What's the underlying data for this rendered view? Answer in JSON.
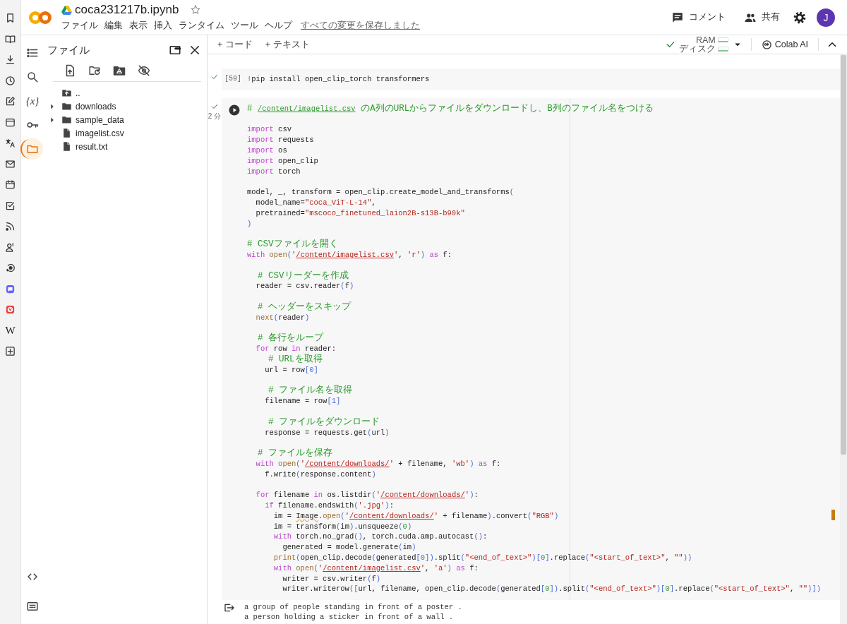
{
  "browser_panels": [
    {
      "kind": "bookmarks"
    },
    {
      "kind": "reader"
    },
    {
      "kind": "downloads"
    },
    {
      "kind": "history"
    },
    {
      "kind": "notes"
    },
    {
      "kind": "tabs"
    },
    {
      "kind": "translate"
    },
    {
      "kind": "mail"
    },
    {
      "kind": "calendar"
    },
    {
      "kind": "tasks"
    },
    {
      "kind": "feeds"
    },
    {
      "kind": "contacts"
    },
    {
      "kind": "chat"
    },
    {
      "kind": "mastodon"
    },
    {
      "kind": "vivaldi"
    },
    {
      "kind": "wikipedia",
      "glyph": "W"
    },
    {
      "kind": "add"
    }
  ],
  "header": {
    "title": "coca231217b.ipynb",
    "menu": [
      "ファイル",
      "編集",
      "表示",
      "挿入",
      "ランタイム",
      "ツール",
      "ヘルプ"
    ],
    "save_status": "すべての変更を保存しました",
    "actions": [
      {
        "kind": "comment",
        "label": "コメント"
      },
      {
        "kind": "share",
        "label": "共有"
      },
      {
        "kind": "settings"
      }
    ],
    "avatar": "J"
  },
  "toolbar": {
    "add_buttons": [
      "+ コード",
      "+ テキスト"
    ],
    "runtime": {
      "connected": true,
      "ram_label": "RAM",
      "disk_label": "ディスク"
    },
    "ai_button": "Colab AI"
  },
  "rail": [
    {
      "kind": "toc",
      "selected": false
    },
    {
      "kind": "search",
      "selected": false
    },
    {
      "kind": "variables",
      "glyph": "{x}",
      "selected": false
    },
    {
      "kind": "secrets",
      "selected": false
    },
    {
      "kind": "files",
      "selected": true
    }
  ],
  "rail_bottom": [
    {
      "kind": "code_snippets"
    },
    {
      "kind": "terminal"
    }
  ],
  "file_panel": {
    "title": "ファイル",
    "tools": [
      {
        "kind": "upload"
      },
      {
        "kind": "refresh"
      },
      {
        "kind": "drive"
      },
      {
        "kind": "hidden"
      }
    ],
    "tree": [
      {
        "kind": "parent",
        "name": ".."
      },
      {
        "kind": "folder",
        "name": "downloads",
        "expanded": false
      },
      {
        "kind": "folder",
        "name": "sample_data",
        "expanded": false
      },
      {
        "kind": "file",
        "name": "imagelist.csv"
      },
      {
        "kind": "file",
        "name": "result.txt"
      }
    ]
  },
  "cells": [
    {
      "executed": true,
      "count": "[59]",
      "lines": [
        {
          "kind": "code",
          "segments": [
            {
              "kind": "punct",
              "text": "!"
            },
            {
              "kind": "plain",
              "text": "pip install open_clip_torch transformers"
            }
          ]
        }
      ]
    },
    {
      "executed": true,
      "elapsed": "2 分",
      "lines": [
        {
          "kind": "code",
          "segments": [
            {
              "kind": "comment",
              "text": "# "
            },
            {
              "kind": "link",
              "text": "/content/imagelist.csv"
            },
            {
              "kind": "comment",
              "text": " のA列のURLからファイルをダウンロードし、B列のファイル名をつける"
            }
          ]
        },
        {
          "kind": "blank"
        },
        {
          "kind": "code",
          "segments": [
            {
              "kind": "keyword",
              "text": "import"
            },
            {
              "kind": "plain",
              "text": " csv"
            }
          ]
        },
        {
          "kind": "code",
          "segments": [
            {
              "kind": "keyword",
              "text": "import"
            },
            {
              "kind": "plain",
              "text": " requests"
            }
          ]
        },
        {
          "kind": "code",
          "segments": [
            {
              "kind": "keyword",
              "text": "import"
            },
            {
              "kind": "plain",
              "text": " os"
            }
          ]
        },
        {
          "kind": "code",
          "segments": [
            {
              "kind": "keyword",
              "text": "import"
            },
            {
              "kind": "plain",
              "text": " open_clip"
            }
          ]
        },
        {
          "kind": "code",
          "segments": [
            {
              "kind": "keyword",
              "text": "import"
            },
            {
              "kind": "plain",
              "text": " torch"
            }
          ]
        },
        {
          "kind": "blank"
        },
        {
          "kind": "code",
          "segments": [
            {
              "kind": "plain",
              "text": "model, _, transform = open_clip.create_model_and_transforms"
            },
            {
              "kind": "punct",
              "text": "("
            }
          ]
        },
        {
          "kind": "code",
          "segments": [
            {
              "kind": "plain",
              "text": "  model_name="
            },
            {
              "kind": "string",
              "text": "\"coca_ViT-L-14\""
            },
            {
              "kind": "plain",
              "text": ","
            }
          ]
        },
        {
          "kind": "code",
          "segments": [
            {
              "kind": "plain",
              "text": "  pretrained="
            },
            {
              "kind": "string",
              "text": "\"mscoco_finetuned_laion2B-s13B-b90k\""
            }
          ]
        },
        {
          "kind": "code",
          "segments": [
            {
              "kind": "punct",
              "text": ")"
            }
          ]
        },
        {
          "kind": "blank"
        },
        {
          "kind": "code",
          "segments": [
            {
              "kind": "comment",
              "text": "# CSVファイルを開く"
            }
          ]
        },
        {
          "kind": "code",
          "segments": [
            {
              "kind": "keyword",
              "text": "with"
            },
            {
              "kind": "builtin",
              "text": " open"
            },
            {
              "kind": "punct",
              "text": "("
            },
            {
              "kind": "string",
              "text": "'"
            },
            {
              "kind": "path",
              "text": "/content/imagelist.csv"
            },
            {
              "kind": "string",
              "text": "'"
            },
            {
              "kind": "plain",
              "text": ", "
            },
            {
              "kind": "string",
              "text": "'r'"
            },
            {
              "kind": "punct",
              "text": ")"
            },
            {
              "kind": "keyword",
              "text": " as"
            },
            {
              "kind": "plain",
              "text": " f:"
            }
          ]
        },
        {
          "kind": "blank"
        },
        {
          "kind": "code",
          "segments": [
            {
              "kind": "comment",
              "text": "  # CSVリーダーを作成"
            }
          ]
        },
        {
          "kind": "code",
          "segments": [
            {
              "kind": "plain",
              "text": "  reader = csv.reader"
            },
            {
              "kind": "punct",
              "text": "("
            },
            {
              "kind": "plain",
              "text": "f"
            },
            {
              "kind": "punct",
              "text": ")"
            }
          ]
        },
        {
          "kind": "blank"
        },
        {
          "kind": "code",
          "segments": [
            {
              "kind": "comment",
              "text": "  # ヘッダーをスキップ"
            }
          ]
        },
        {
          "kind": "code",
          "segments": [
            {
              "kind": "builtin",
              "text": "  next"
            },
            {
              "kind": "punct",
              "text": "("
            },
            {
              "kind": "plain",
              "text": "reader"
            },
            {
              "kind": "punct",
              "text": ")"
            }
          ]
        },
        {
          "kind": "blank"
        },
        {
          "kind": "code",
          "segments": [
            {
              "kind": "comment",
              "text": "  # 各行をループ"
            }
          ]
        },
        {
          "kind": "code",
          "segments": [
            {
              "kind": "keyword",
              "text": "  for"
            },
            {
              "kind": "plain",
              "text": " row "
            },
            {
              "kind": "keyword",
              "text": "in"
            },
            {
              "kind": "plain",
              "text": " reader:"
            }
          ]
        },
        {
          "kind": "code",
          "segments": [
            {
              "kind": "comment",
              "text": "    # URLを取得"
            }
          ]
        },
        {
          "kind": "code",
          "segments": [
            {
              "kind": "plain",
              "text": "    url = row"
            },
            {
              "kind": "punct",
              "text": "[0]"
            }
          ]
        },
        {
          "kind": "blank"
        },
        {
          "kind": "code",
          "segments": [
            {
              "kind": "comment",
              "text": "    # ファイル名を取得"
            }
          ]
        },
        {
          "kind": "code",
          "segments": [
            {
              "kind": "plain",
              "text": "    filename = row"
            },
            {
              "kind": "punct",
              "text": "[1]"
            }
          ]
        },
        {
          "kind": "blank"
        },
        {
          "kind": "code",
          "segments": [
            {
              "kind": "comment",
              "text": "    # ファイルをダウンロード"
            }
          ]
        },
        {
          "kind": "code",
          "segments": [
            {
              "kind": "plain",
              "text": "    response = requests.get"
            },
            {
              "kind": "punct",
              "text": "("
            },
            {
              "kind": "plain",
              "text": "url"
            },
            {
              "kind": "punct",
              "text": ")"
            }
          ]
        },
        {
          "kind": "blank"
        },
        {
          "kind": "code",
          "segments": [
            {
              "kind": "comment",
              "text": "  # ファイルを保存"
            }
          ]
        },
        {
          "kind": "code",
          "segments": [
            {
              "kind": "keyword",
              "text": "  with"
            },
            {
              "kind": "builtin",
              "text": " open"
            },
            {
              "kind": "punct",
              "text": "("
            },
            {
              "kind": "string",
              "text": "'"
            },
            {
              "kind": "path",
              "text": "/content/downloads/"
            },
            {
              "kind": "string",
              "text": "'"
            },
            {
              "kind": "plain",
              "text": " + filename, "
            },
            {
              "kind": "string",
              "text": "'wb'"
            },
            {
              "kind": "punct",
              "text": ")"
            },
            {
              "kind": "keyword",
              "text": " as"
            },
            {
              "kind": "plain",
              "text": " f:"
            }
          ]
        },
        {
          "kind": "code",
          "segments": [
            {
              "kind": "plain",
              "text": "    f.write"
            },
            {
              "kind": "punct",
              "text": "("
            },
            {
              "kind": "plain",
              "text": "response.content"
            },
            {
              "kind": "punct",
              "text": ")"
            }
          ]
        },
        {
          "kind": "blank"
        },
        {
          "kind": "code",
          "segments": [
            {
              "kind": "keyword",
              "text": "  for"
            },
            {
              "kind": "plain",
              "text": " filename "
            },
            {
              "kind": "keyword",
              "text": "in"
            },
            {
              "kind": "plain",
              "text": " os.listdir"
            },
            {
              "kind": "punct",
              "text": "("
            },
            {
              "kind": "string",
              "text": "'"
            },
            {
              "kind": "path",
              "text": "/content/downloads/"
            },
            {
              "kind": "string",
              "text": "'"
            },
            {
              "kind": "punct",
              "text": ")"
            },
            {
              "kind": "plain",
              "text": ":"
            }
          ]
        },
        {
          "kind": "code",
          "segments": [
            {
              "kind": "keyword",
              "text": "    if"
            },
            {
              "kind": "plain",
              "text": " filename.endswith"
            },
            {
              "kind": "punct",
              "text": "("
            },
            {
              "kind": "string",
              "text": "'.jpg'"
            },
            {
              "kind": "punct",
              "text": ")"
            },
            {
              "kind": "plain",
              "text": ":"
            }
          ]
        },
        {
          "kind": "code",
          "segments": [
            {
              "kind": "plain",
              "text": "      im = "
            },
            {
              "kind": "flagged",
              "text": "Image"
            },
            {
              "kind": "plain",
              "text": "."
            },
            {
              "kind": "builtin",
              "text": "open"
            },
            {
              "kind": "punct",
              "text": "("
            },
            {
              "kind": "string",
              "text": "'"
            },
            {
              "kind": "path",
              "text": "/content/downloads/"
            },
            {
              "kind": "string",
              "text": "'"
            },
            {
              "kind": "plain",
              "text": " + filename"
            },
            {
              "kind": "punct",
              "text": ")"
            },
            {
              "kind": "plain",
              "text": ".convert"
            },
            {
              "kind": "punct",
              "text": "("
            },
            {
              "kind": "string",
              "text": "\"RGB\""
            },
            {
              "kind": "punct",
              "text": ")"
            }
          ]
        },
        {
          "kind": "code",
          "segments": [
            {
              "kind": "plain",
              "text": "      im = transform"
            },
            {
              "kind": "punct",
              "text": "("
            },
            {
              "kind": "plain",
              "text": "im"
            },
            {
              "kind": "punct",
              "text": ")"
            },
            {
              "kind": "plain",
              "text": ".unsqueeze"
            },
            {
              "kind": "punct",
              "text": "("
            },
            {
              "kind": "number",
              "text": "0"
            },
            {
              "kind": "punct",
              "text": ")"
            }
          ]
        },
        {
          "kind": "code",
          "segments": [
            {
              "kind": "keyword",
              "text": "      with"
            },
            {
              "kind": "plain",
              "text": " torch.no_grad"
            },
            {
              "kind": "punct",
              "text": "()"
            },
            {
              "kind": "plain",
              "text": ", torch.cuda.amp.autocast"
            },
            {
              "kind": "punct",
              "text": "()"
            },
            {
              "kind": "plain",
              "text": ":"
            }
          ]
        },
        {
          "kind": "code",
          "segments": [
            {
              "kind": "plain",
              "text": "        generated = model.generate"
            },
            {
              "kind": "punct",
              "text": "("
            },
            {
              "kind": "plain",
              "text": "im"
            },
            {
              "kind": "punct",
              "text": ")"
            }
          ]
        },
        {
          "kind": "code",
          "segments": [
            {
              "kind": "builtin",
              "text": "      print"
            },
            {
              "kind": "punct",
              "text": "("
            },
            {
              "kind": "plain",
              "text": "open_clip.decode"
            },
            {
              "kind": "punct",
              "text": "("
            },
            {
              "kind": "plain",
              "text": "generated"
            },
            {
              "kind": "punct",
              "text": "["
            },
            {
              "kind": "number",
              "text": "0"
            },
            {
              "kind": "punct",
              "text": "])"
            },
            {
              "kind": "plain",
              "text": ".split"
            },
            {
              "kind": "punct",
              "text": "("
            },
            {
              "kind": "string",
              "text": "\"<end_of_text>\""
            },
            {
              "kind": "punct",
              "text": ")["
            },
            {
              "kind": "number",
              "text": "0"
            },
            {
              "kind": "punct",
              "text": "]"
            },
            {
              "kind": "plain",
              "text": ".replace"
            },
            {
              "kind": "punct",
              "text": "("
            },
            {
              "kind": "string",
              "text": "\"<start_of_text>\""
            },
            {
              "kind": "plain",
              "text": ", "
            },
            {
              "kind": "string",
              "text": "\"\""
            },
            {
              "kind": "punct",
              "text": "))"
            }
          ]
        },
        {
          "kind": "code",
          "segments": [
            {
              "kind": "keyword",
              "text": "      with"
            },
            {
              "kind": "builtin",
              "text": " open"
            },
            {
              "kind": "punct",
              "text": "("
            },
            {
              "kind": "string",
              "text": "'"
            },
            {
              "kind": "path",
              "text": "/content/imagelist.csv"
            },
            {
              "kind": "string",
              "text": "'"
            },
            {
              "kind": "plain",
              "text": ", "
            },
            {
              "kind": "string",
              "text": "'a'"
            },
            {
              "kind": "punct",
              "text": ")"
            },
            {
              "kind": "keyword",
              "text": " as"
            },
            {
              "kind": "plain",
              "text": " f:"
            }
          ]
        },
        {
          "kind": "code",
          "segments": [
            {
              "kind": "plain",
              "text": "        writer = csv.writer"
            },
            {
              "kind": "punct",
              "text": "("
            },
            {
              "kind": "plain",
              "text": "f"
            },
            {
              "kind": "punct",
              "text": ")"
            }
          ]
        },
        {
          "kind": "code",
          "segments": [
            {
              "kind": "plain",
              "text": "        writer.writerow"
            },
            {
              "kind": "punct",
              "text": "(["
            },
            {
              "kind": "plain",
              "text": "url, filename, open_clip.decode"
            },
            {
              "kind": "punct",
              "text": "("
            },
            {
              "kind": "plain",
              "text": "generated"
            },
            {
              "kind": "punct",
              "text": "["
            },
            {
              "kind": "number",
              "text": "0"
            },
            {
              "kind": "punct",
              "text": "])"
            },
            {
              "kind": "plain",
              "text": ".split"
            },
            {
              "kind": "punct",
              "text": "("
            },
            {
              "kind": "string",
              "text": "\"<end_of_text>\""
            },
            {
              "kind": "punct",
              "text": ")["
            },
            {
              "kind": "number",
              "text": "0"
            },
            {
              "kind": "punct",
              "text": "]"
            },
            {
              "kind": "plain",
              "text": ".replace"
            },
            {
              "kind": "punct",
              "text": "("
            },
            {
              "kind": "string",
              "text": "\"<start_of_text>\""
            },
            {
              "kind": "plain",
              "text": ", "
            },
            {
              "kind": "string",
              "text": "\"\""
            },
            {
              "kind": "punct",
              "text": ")])"
            }
          ]
        }
      ],
      "output": [
        "a group of people standing in front of a poster .",
        "a person holding a sticker in front of a wall ."
      ]
    }
  ]
}
